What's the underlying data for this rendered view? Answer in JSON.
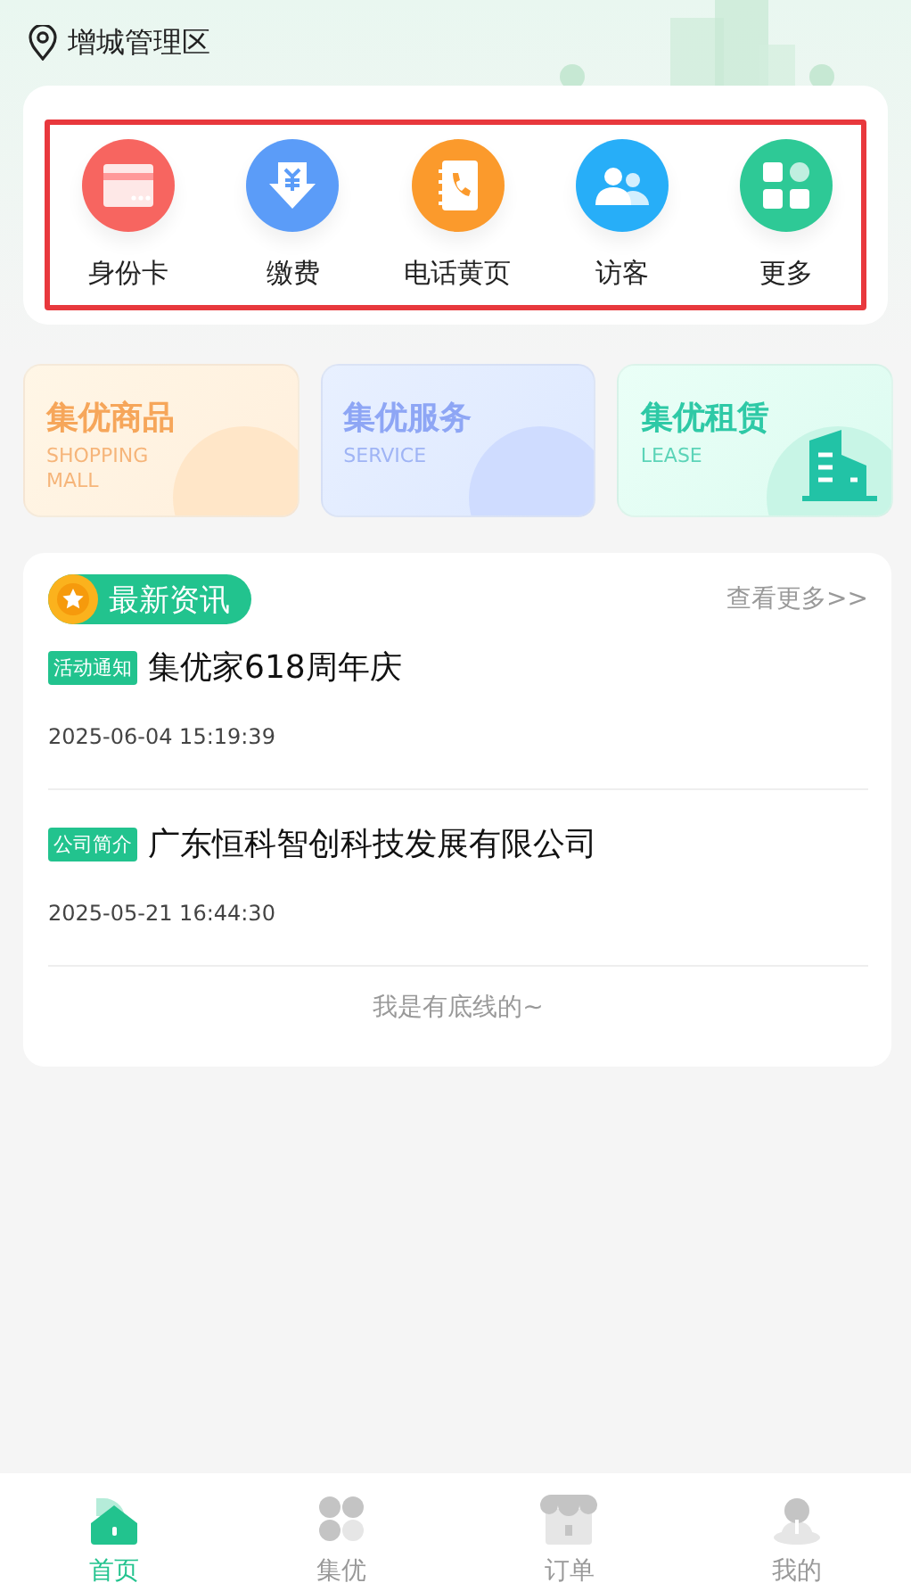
{
  "location": {
    "name": "增城管理区"
  },
  "shortcuts": {
    "highlighted": true,
    "items": [
      {
        "label": "身份卡",
        "kind": "card",
        "color": "#f76560"
      },
      {
        "label": "缴费",
        "kind": "payment",
        "color": "#5b9cf8"
      },
      {
        "label": "电话黄页",
        "kind": "phonebook",
        "color": "#fb9a2c"
      },
      {
        "label": "访客",
        "kind": "visitor",
        "color": "#27aef8"
      },
      {
        "label": "更多",
        "kind": "more",
        "color": "#2ec996"
      }
    ]
  },
  "promos": [
    {
      "kind": "shopping",
      "title": "集优商品",
      "subtitle": "SHOPPING MALL"
    },
    {
      "kind": "service",
      "title": "集优服务",
      "subtitle": "SERVICE"
    },
    {
      "kind": "lease",
      "title": "集优租赁",
      "subtitle": "LEASE"
    }
  ],
  "news": {
    "title": "最新资讯",
    "more": "查看更多>>",
    "items": [
      {
        "tag": "活动通知",
        "title": "集优家618周年庆",
        "time": "2025-06-04 15:19:39"
      },
      {
        "tag": "公司简介",
        "title": "广东恒科智创科技发展有限公司",
        "time": "2025-05-21 16:44:30"
      }
    ],
    "footer": "我是有底线的~"
  },
  "tabbar": [
    {
      "label": "首页",
      "kind": "home",
      "selected": true
    },
    {
      "label": "集优",
      "kind": "grid",
      "selected": false
    },
    {
      "label": "订单",
      "kind": "shop",
      "selected": false
    },
    {
      "label": "我的",
      "kind": "user",
      "selected": false
    }
  ]
}
